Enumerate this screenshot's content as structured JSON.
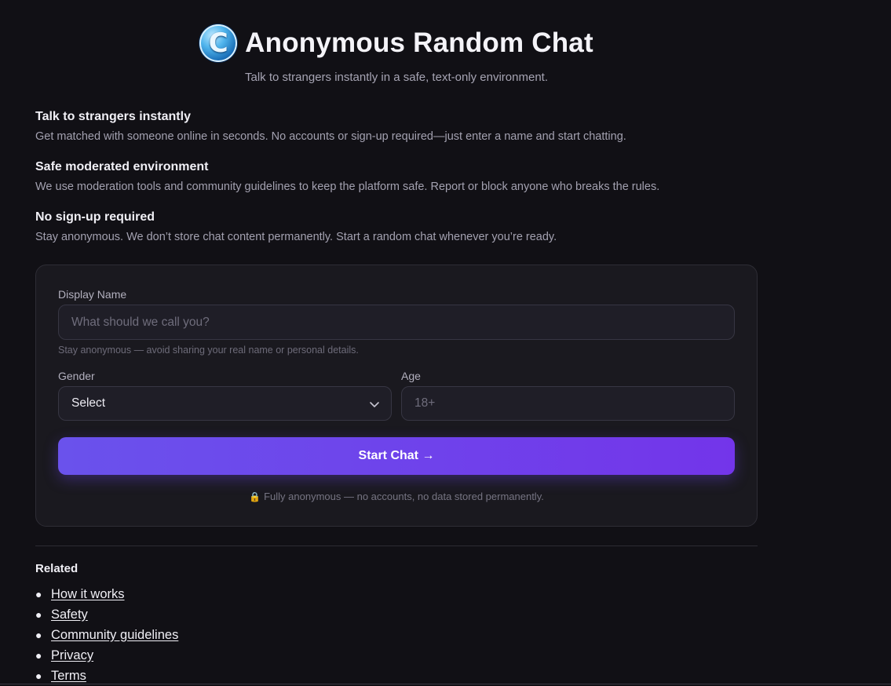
{
  "header": {
    "logo_letter": "C",
    "title": "Anonymous Random Chat",
    "subtitle": "Talk to strangers instantly in a safe, text-only environment."
  },
  "features": [
    {
      "title": "Talk to strangers instantly",
      "description": "Get matched with someone online in seconds. No accounts or sign-up required—just enter a name and start chatting."
    },
    {
      "title": "Safe moderated environment",
      "description": "We use moderation tools and community guidelines to keep the platform safe. Report or block anyone who breaks the rules."
    },
    {
      "title": "No sign-up required",
      "description": "Stay anonymous. We don’t store chat content permanently. Start a random chat whenever you’re ready."
    }
  ],
  "form": {
    "display_name_label": "Display Name",
    "display_name_placeholder": "What should we call you?",
    "display_name_hint": "Stay anonymous — avoid sharing your real name or personal details.",
    "gender_label": "Gender",
    "gender_selected": "Select",
    "age_label": "Age",
    "age_placeholder": "18+",
    "start_button_label": "Start Chat →",
    "privacy_note_icon": "🔒",
    "privacy_note": "Fully anonymous — no accounts, no data stored permanently."
  },
  "related": {
    "title": "Related",
    "links": [
      "How it works",
      "Safety",
      "Community guidelines",
      "Privacy",
      "Terms"
    ]
  },
  "colors": {
    "background": "#111015",
    "card": "#1a191f",
    "accent_start": "#6a52ec",
    "accent_end": "#7335ea"
  },
  "icons": {
    "logo": "logo-c-icon",
    "select_arrow": "chevron-down-icon",
    "privacy": "lock-icon"
  }
}
